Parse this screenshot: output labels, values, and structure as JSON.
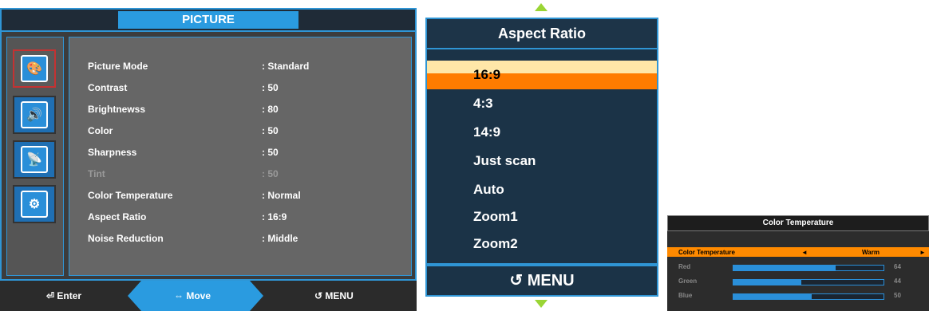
{
  "picture": {
    "title": "PICTURE",
    "items": [
      {
        "label": "Picture Mode",
        "value": ": Standard"
      },
      {
        "label": "Contrast",
        "value": ": 50"
      },
      {
        "label": "Brightnewss",
        "value": ": 80"
      },
      {
        "label": "Color",
        "value": ": 50"
      },
      {
        "label": "Sharpness",
        "value": ": 50"
      },
      {
        "label": "Tint",
        "value": ": 50"
      },
      {
        "label": "Color Temperature",
        "value": ": Normal"
      },
      {
        "label": "Aspect Ratio",
        "value": ": 16:9"
      },
      {
        "label": "Noise Reduction",
        "value": ": Middle"
      }
    ],
    "sidebar_icons": [
      "picture-icon",
      "sound-icon",
      "setup-icon",
      "settings-icon"
    ],
    "footer": {
      "enter": "Enter",
      "move": "Move",
      "menu": "MENU"
    }
  },
  "aspect": {
    "title": "Aspect Ratio",
    "items": [
      "16:9",
      "4:3",
      "14:9",
      "Just scan",
      "Auto",
      "Zoom1",
      "Zoom2"
    ],
    "selected_index": 0,
    "footer": "MENU"
  },
  "colortemp": {
    "title": "Color Temperature",
    "row_label": "Color Temperature",
    "row_value": "Warm",
    "channels": [
      {
        "label": "Red",
        "value": "64",
        "fraction": 0.68
      },
      {
        "label": "Green",
        "value": "44",
        "fraction": 0.45
      },
      {
        "label": "Blue",
        "value": "50",
        "fraction": 0.52
      }
    ]
  },
  "colors": {
    "accent_blue": "#2a9be0",
    "highlight_orange": "#ff7c00",
    "arrow_green": "#9ad535"
  }
}
